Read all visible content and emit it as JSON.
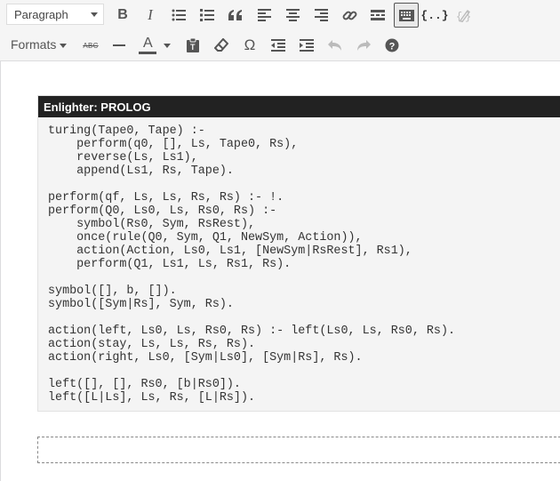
{
  "toolbar": {
    "paragraph_select": "Paragraph",
    "formats_label": "Formats",
    "row1_icons": [
      "bold-icon",
      "italic-icon",
      "bulleted-list-icon",
      "numbered-list-icon",
      "blockquote-icon",
      "align-left-icon",
      "align-center-icon",
      "align-right-icon",
      "link-icon",
      "read-more-icon",
      "toolbar-toggle-icon",
      "code-icon",
      "code-edit-icon"
    ],
    "row2_icons": [
      "strikethrough-icon",
      "horizontal-line-icon",
      "text-color-icon",
      "paste-as-text-icon",
      "clear-formatting-icon",
      "special-character-icon",
      "outdent-icon",
      "indent-icon",
      "undo-icon",
      "redo-icon",
      "help-icon"
    ],
    "bold_glyph": "B",
    "italic_glyph": "I",
    "code_glyph": "{..}",
    "strike_glyph": "ABC",
    "text_color_glyph": "A",
    "omega_glyph": "Ω"
  },
  "editor": {
    "code_header": "Enlighter: PROLOG",
    "code": "turing(Tape0, Tape) :-\n    perform(q0, [], Ls, Tape0, Rs),\n    reverse(Ls, Ls1),\n    append(Ls1, Rs, Tape).\n\nperform(qf, Ls, Ls, Rs, Rs) :- !.\nperform(Q0, Ls0, Ls, Rs0, Rs) :-\n    symbol(Rs0, Sym, RsRest),\n    once(rule(Q0, Sym, Q1, NewSym, Action)),\n    action(Action, Ls0, Ls1, [NewSym|RsRest], Rs1),\n    perform(Q1, Ls1, Ls, Rs1, Rs).\n\nsymbol([], b, []).\nsymbol([Sym|Rs], Sym, Rs).\n\naction(left, Ls0, Ls, Rs0, Rs) :- left(Ls0, Ls, Rs0, Rs).\naction(stay, Ls, Ls, Rs, Rs).\naction(right, Ls0, [Sym|Ls0], [Sym|Rs], Rs).\n\nleft([], [], Rs0, [b|Rs0]).\nleft([L|Ls], Ls, Rs, [L|Rs])."
  },
  "colors": {
    "toolbar_bg": "#f5f5f5",
    "icon": "#555555",
    "header_bg": "#222222",
    "code_bg": "#f4f4f4"
  }
}
